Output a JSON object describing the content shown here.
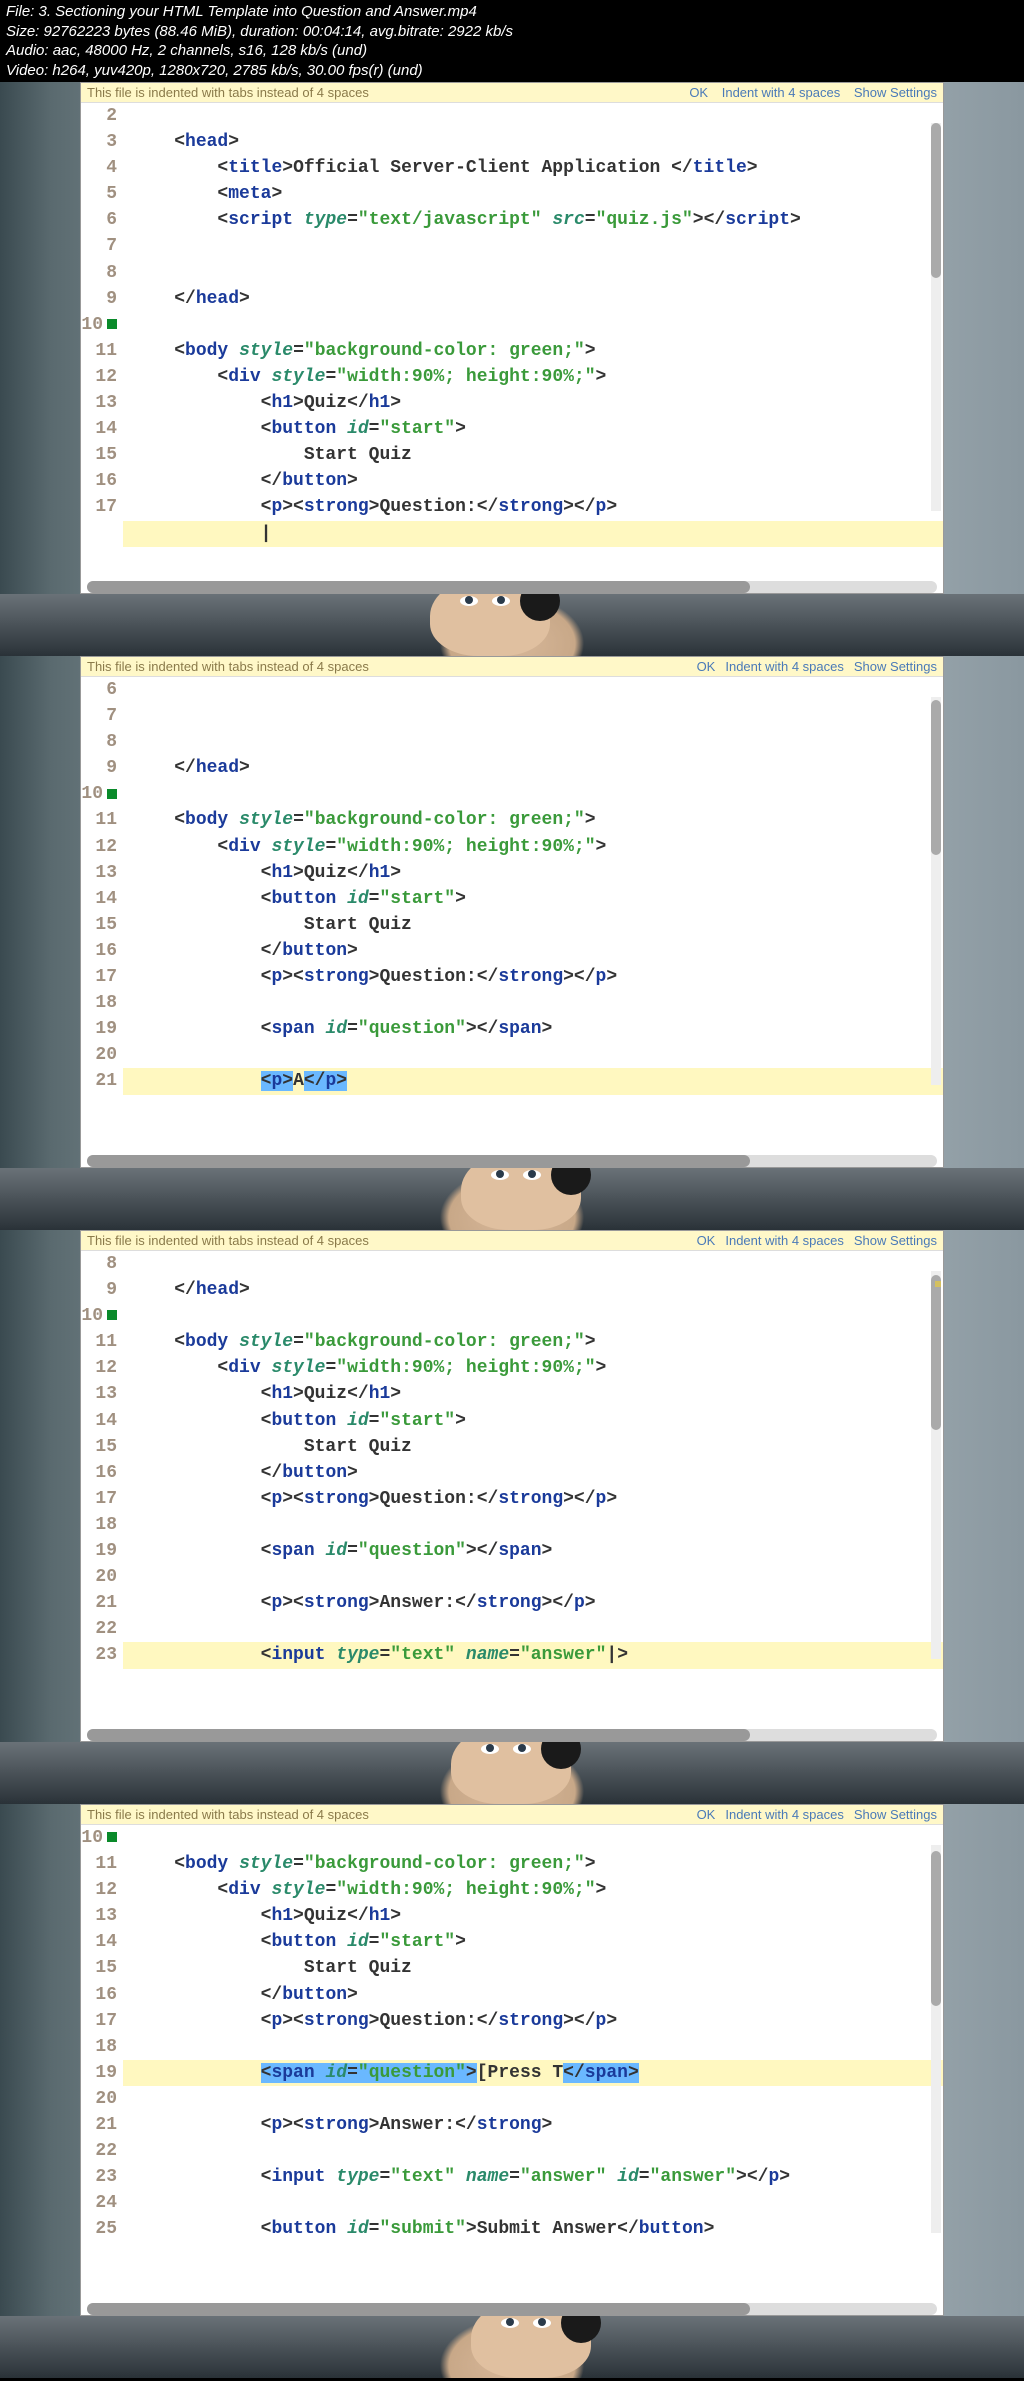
{
  "meta": {
    "file_line": "File: 3. Sectioning your HTML Template into Question and Answer.mp4",
    "size_line": "Size: 92762223 bytes (88.46 MiB), duration: 00:04:14, avg.bitrate: 2922 kb/s",
    "audio_line": "Audio: aac, 48000 Hz, 2 channels, s16, 128 kb/s (und)",
    "video_line": "Video: h264, yuv420p, 1280x720, 2785 kb/s, 30.00 fps(r) (und)"
  },
  "lint": {
    "message": "This file is indented with tabs instead of 4 spaces",
    "action_ok": "OK",
    "action_indent": "Indent with 4 spaces",
    "action_settings": "Show Settings"
  },
  "frame1": {
    "lines": [
      "2",
      "3",
      "4",
      "5",
      "6",
      "7",
      "8",
      "9",
      "10",
      "11",
      "12",
      "13",
      "14",
      "15",
      "16",
      "17"
    ],
    "body_marker_line": "10",
    "code": {
      "l2": "    <head>",
      "l3": "        <title>Official Server-Client Application </title>",
      "l4": "        <meta>",
      "l5": "        <script type=\"text/javascript\" src=\"quiz.js\"></script>",
      "l6": "",
      "l7": "",
      "l8": "    </head>",
      "l9": "",
      "l10": "    <body style=\"background-color: green;\">",
      "l11": "        <div style=\"width:90%; height:90%;\">",
      "l12": "            <h1>Quiz</h1>",
      "l13": "            <button id=\"start\">",
      "l14": "                Start Quiz",
      "l15": "            </button>",
      "l16": "            <p><strong>Question:</strong></p>",
      "l17": "            |"
    }
  },
  "frame2": {
    "lines": [
      "6",
      "7",
      "8",
      "9",
      "10",
      "11",
      "12",
      "13",
      "14",
      "15",
      "16",
      "17",
      "18",
      "19",
      "20",
      "21"
    ],
    "body_marker_line": "10",
    "highlight_line": "20",
    "code": {
      "l6": "",
      "l7": "",
      "l8": "    </head>",
      "l9": "",
      "l10": "    <body style=\"background-color: green;\">",
      "l11": "        <div style=\"width:90%; height:90%;\">",
      "l12": "            <h1>Quiz</h1>",
      "l13": "            <button id=\"start\">",
      "l14": "                Start Quiz",
      "l15": "            </button>",
      "l16": "            <p><strong>Question:</strong></p>",
      "l17": "",
      "l18": "            <span id=\"question\"></span>",
      "l19": "",
      "l20": "            <p>A|</p>",
      "l21": ""
    }
  },
  "frame3": {
    "lines": [
      "8",
      "9",
      "10",
      "11",
      "12",
      "13",
      "14",
      "15",
      "16",
      "17",
      "18",
      "19",
      "20",
      "21",
      "22",
      "23"
    ],
    "body_marker_line": "10",
    "highlight_line": "22",
    "code": {
      "l8": "    </head>",
      "l9": "",
      "l10": "    <body style=\"background-color: green;\">",
      "l11": "        <div style=\"width:90%; height:90%;\">",
      "l12": "            <h1>Quiz</h1>",
      "l13": "            <button id=\"start\">",
      "l14": "                Start Quiz",
      "l15": "            </button>",
      "l16": "            <p><strong>Question:</strong></p>",
      "l17": "",
      "l18": "            <span id=\"question\"></span>",
      "l19": "",
      "l20": "            <p><strong>Answer:</strong></p>",
      "l21": "",
      "l22": "            <input type=\"text\" name=\"answer\"|>",
      "l23": ""
    }
  },
  "frame4": {
    "lines": [
      "10",
      "11",
      "12",
      "13",
      "14",
      "15",
      "16",
      "17",
      "18",
      "19",
      "20",
      "21",
      "22",
      "23",
      "24",
      "25"
    ],
    "body_marker_line": "10",
    "highlight_line": "18",
    "code": {
      "l10": "    <body style=\"background-color: green;\">",
      "l11": "        <div style=\"width:90%; height:90%;\">",
      "l12": "            <h1>Quiz</h1>",
      "l13": "            <button id=\"start\">",
      "l14": "                Start Quiz",
      "l15": "            </button>",
      "l16": "            <p><strong>Question:</strong></p>",
      "l17": "",
      "l18": "            <span id=\"question\">[Press T|</span>",
      "l19": "",
      "l20": "            <p><strong>Answer:</strong>",
      "l21": "",
      "l22": "            <input type=\"text\" name=\"answer\" id=\"answer\"></p>",
      "l23": "",
      "l24": "            <button id=\"submit\">Submit Answer</button>",
      "l25": ""
    }
  }
}
